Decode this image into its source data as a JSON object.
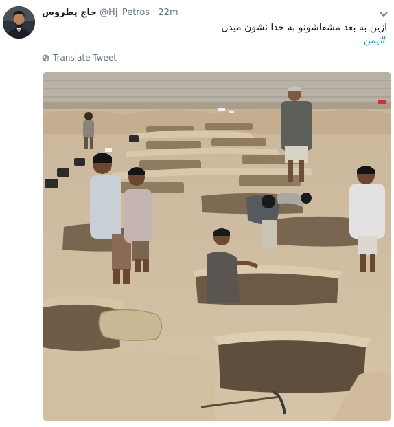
{
  "tweet": {
    "display_name": "حاج پطروس",
    "handle": "@Hj_Petros",
    "separator": "·",
    "time": "22m",
    "text": "ازین به بعد مشقاشونو به خدا نشون میدن",
    "hashtag": "#یمن",
    "translate_label": "Translate Tweet"
  },
  "icons": {
    "menu": "chevron-down-icon",
    "translate": "globe-icon"
  },
  "colors": {
    "link": "#1b95e0",
    "muted": "#657786",
    "text": "#14171a"
  }
}
